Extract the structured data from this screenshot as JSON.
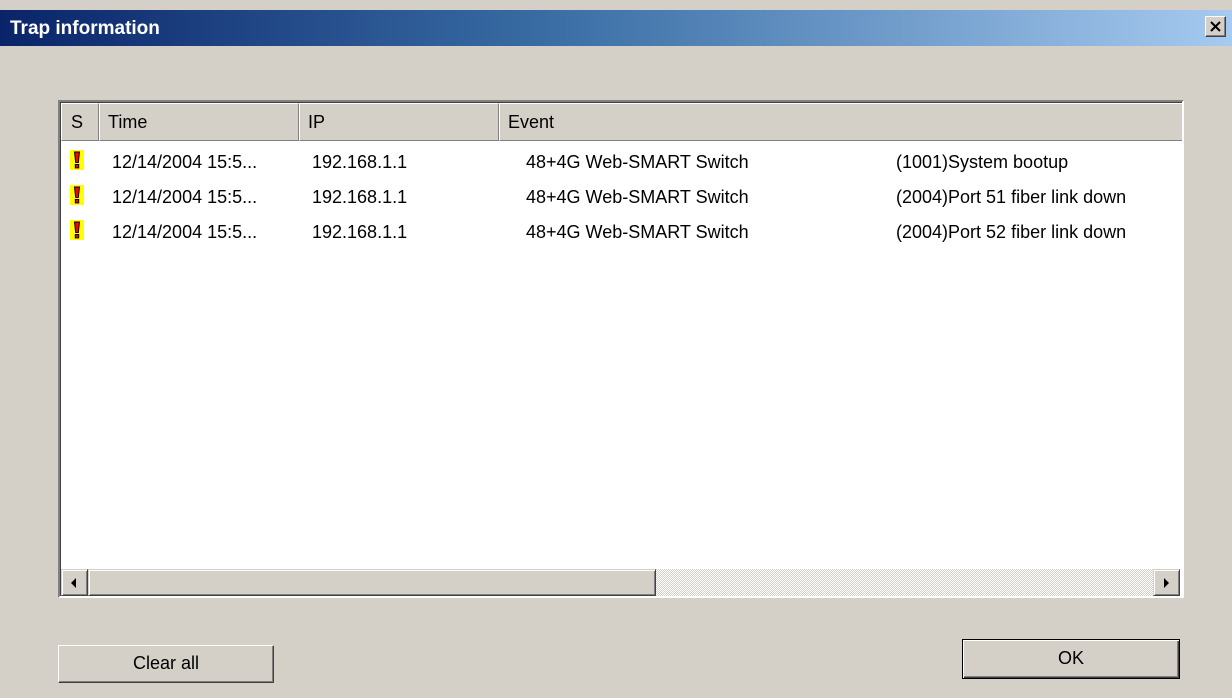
{
  "window": {
    "title": "Trap information"
  },
  "table": {
    "columns": [
      "S",
      "Time",
      "IP",
      "Event"
    ],
    "rows": [
      {
        "severity_icon": "warning-exclamation-icon",
        "time": "12/14/2004 15:5...",
        "ip": "192.168.1.1",
        "device": "48+4G Web-SMART Switch",
        "message": "(1001)System bootup"
      },
      {
        "severity_icon": "warning-exclamation-icon",
        "time": "12/14/2004 15:5...",
        "ip": "192.168.1.1",
        "device": "48+4G Web-SMART Switch",
        "message": "(2004)Port 51 fiber link down"
      },
      {
        "severity_icon": "warning-exclamation-icon",
        "time": "12/14/2004 15:5...",
        "ip": "192.168.1.1",
        "device": "48+4G Web-SMART Switch",
        "message": "(2004)Port 52 fiber link down"
      }
    ]
  },
  "buttons": {
    "clear_all": "Clear all",
    "ok": "OK"
  },
  "colors": {
    "title_start": "#0a246a",
    "title_end": "#a6caf0",
    "face": "#d4d0c8",
    "warning_yellow": "#ffff00",
    "warning_red": "#ff0000"
  }
}
